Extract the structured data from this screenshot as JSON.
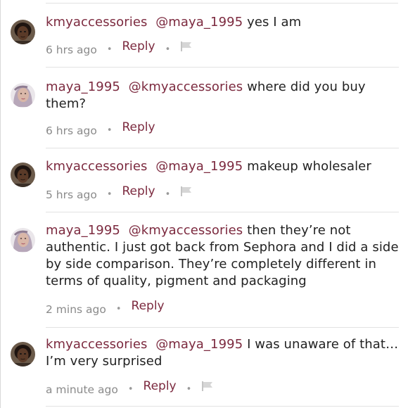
{
  "comments": [
    {
      "author": "kmyaccessories",
      "mention": "@maya_1995",
      "body": " yes I am",
      "time": "6 hrs ago",
      "reply_label": "Reply",
      "has_flag": true,
      "avatar": "kmy-avatar"
    },
    {
      "author": "maya_1995",
      "mention": "@kmyaccessories",
      "body": " where did you buy them?",
      "time": "6 hrs ago",
      "reply_label": "Reply",
      "has_flag": false,
      "avatar": "maya-avatar"
    },
    {
      "author": "kmyaccessories",
      "mention": "@maya_1995",
      "body": " makeup wholesaler",
      "time": "5 hrs ago",
      "reply_label": "Reply",
      "has_flag": true,
      "avatar": "kmy-avatar"
    },
    {
      "author": "maya_1995",
      "mention": "@kmyaccessories",
      "body": " then they’re not authentic. I just got back from Sephora and I did a side by side comparison. They’re completely different in terms of quality, pigment and packaging",
      "time": "2 mins ago",
      "reply_label": "Reply",
      "has_flag": false,
      "avatar": "maya-avatar"
    },
    {
      "author": "kmyaccessories",
      "mention": "@maya_1995",
      "body": " I was unaware of that…I’m very surprised",
      "time": "a minute ago",
      "reply_label": "Reply",
      "has_flag": true,
      "avatar": "kmy-avatar"
    }
  ],
  "separator": "•",
  "colors": {
    "accent": "#7c2a3f",
    "text": "#222222",
    "muted": "#8a8a8a",
    "divider": "#e2e2e2"
  },
  "icons": {
    "flag": "flag-icon",
    "dot": "bullet-separator"
  }
}
